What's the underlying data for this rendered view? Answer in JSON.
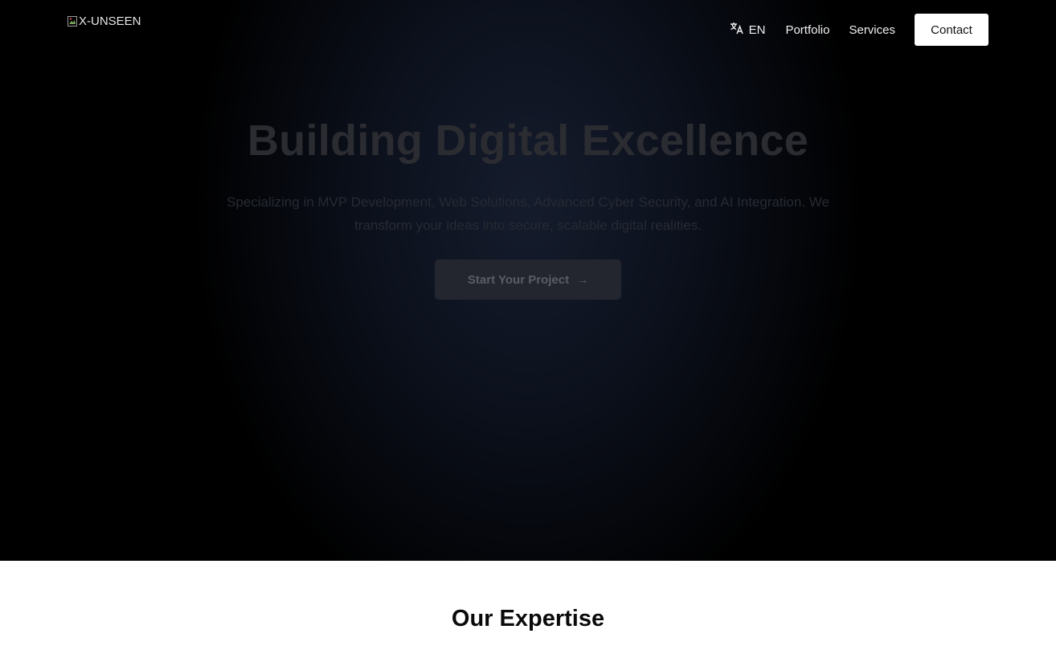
{
  "nav": {
    "logo_alt": "X-UNSEEN",
    "language": "EN",
    "links": [
      "Portfolio",
      "Services"
    ],
    "contact_label": "Contact"
  },
  "hero": {
    "title": "Building Digital Excellence",
    "subtitle": "Specializing in MVP Development, Web Solutions, Advanced Cyber Security, and AI Integration. We transform your ideas into secure, scalable digital realities.",
    "cta_label": "Start Your Project",
    "cta_icon": "arrow-right-icon"
  },
  "expertise": {
    "title": "Our Expertise"
  },
  "colors": {
    "hero_bg": "#000000",
    "contact_bg": "#ffffff",
    "cta_bg": "#23262e"
  }
}
